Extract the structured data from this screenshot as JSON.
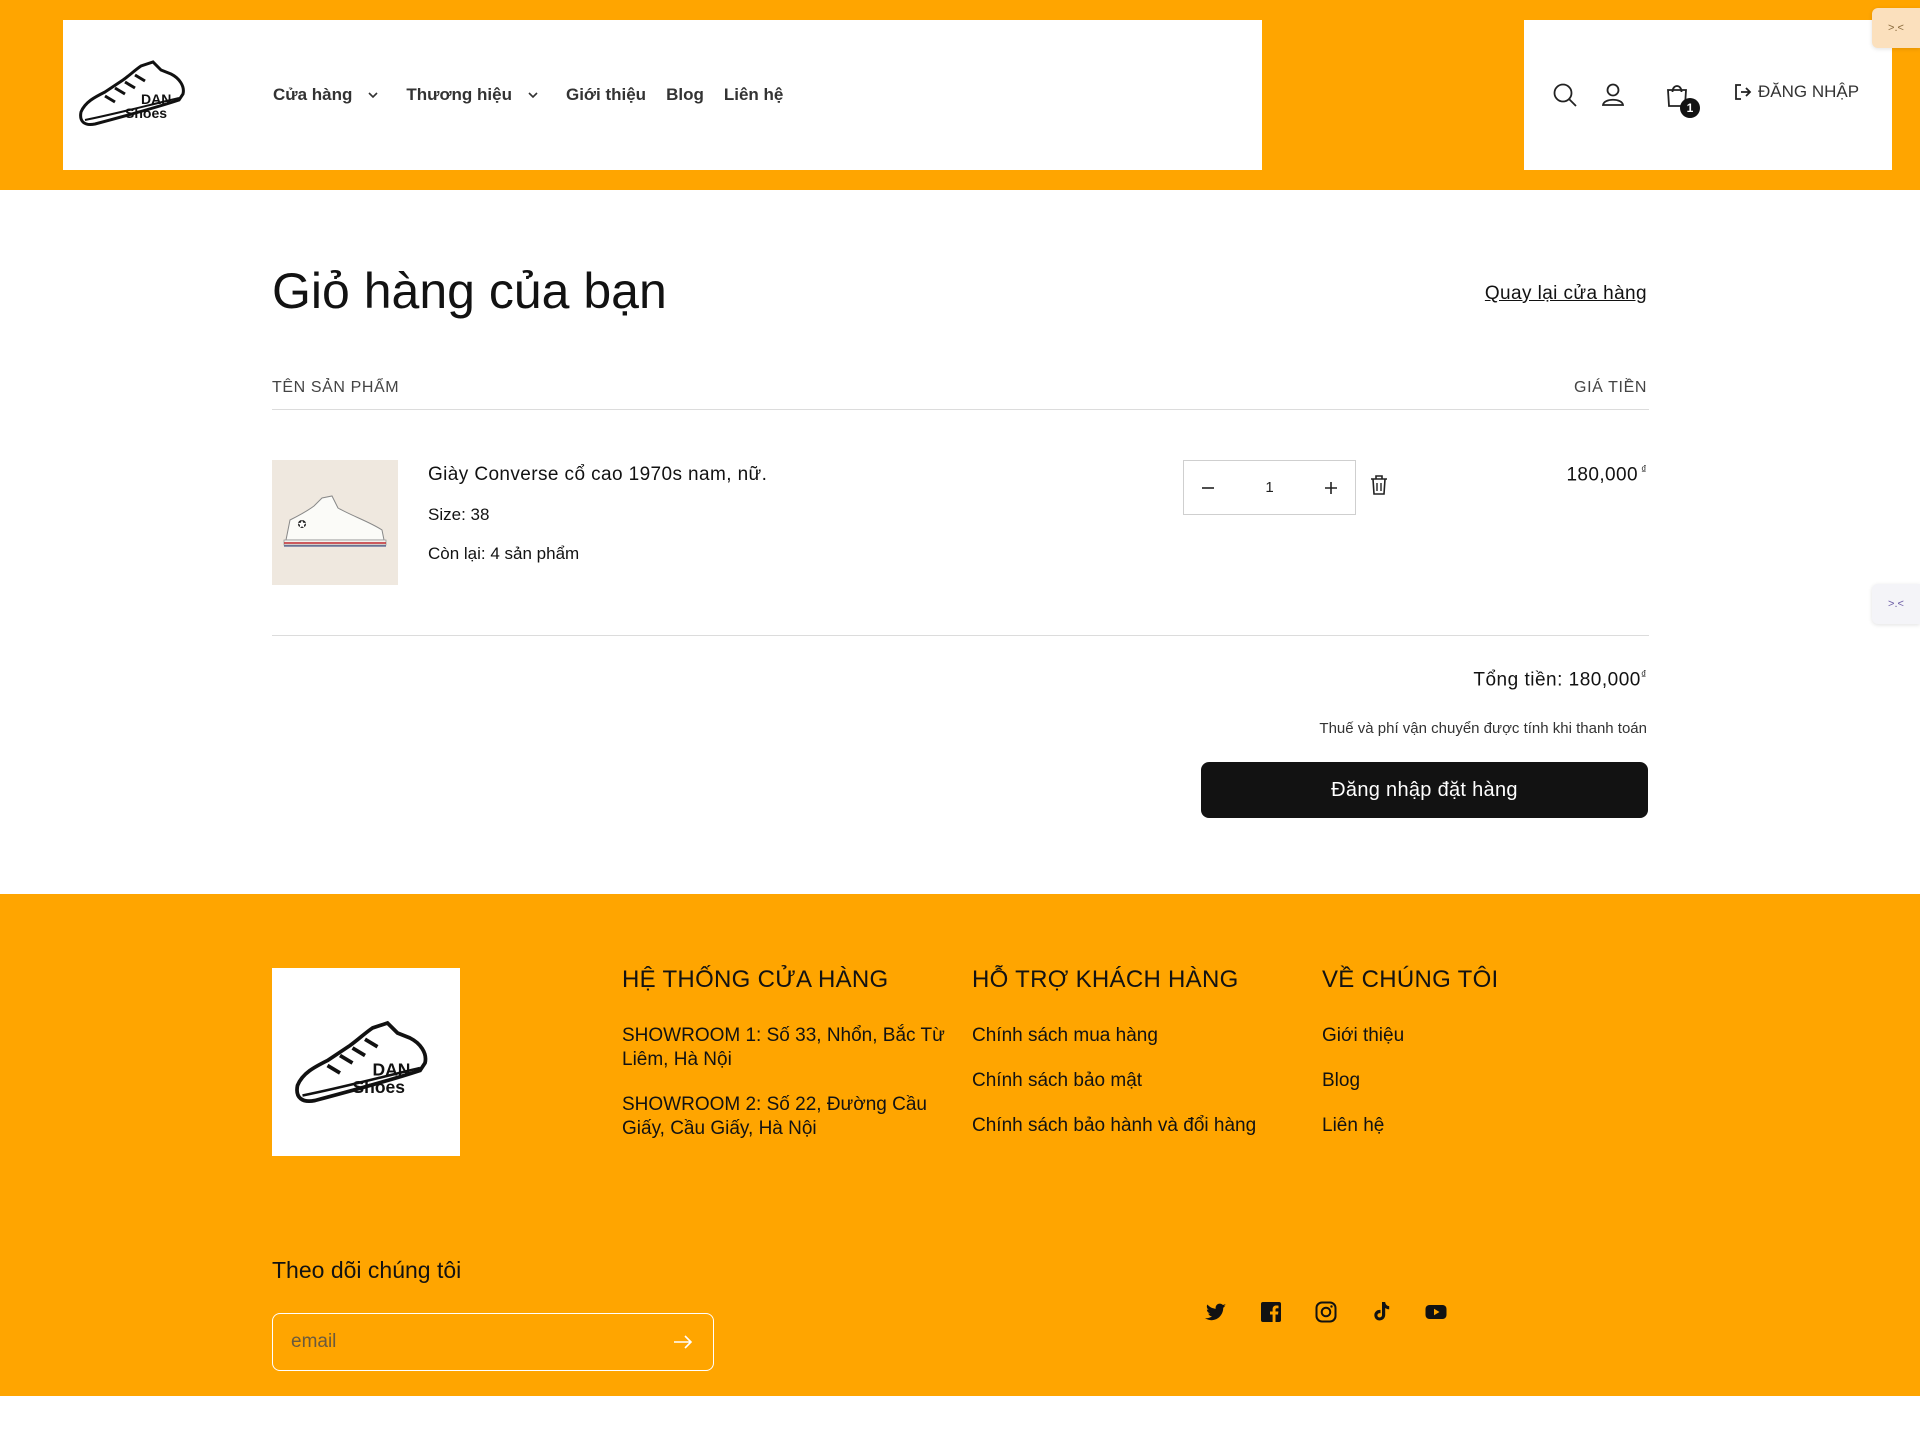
{
  "header": {
    "brand": "DAN Shoes",
    "brand_line1": "DAN",
    "brand_line2": "Shoes",
    "nav": [
      {
        "label": "Cửa hàng",
        "has_dropdown": true
      },
      {
        "label": "Thương hiệu",
        "has_dropdown": true
      },
      {
        "label": "Giới thiệu",
        "has_dropdown": false
      },
      {
        "label": "Blog",
        "has_dropdown": false
      },
      {
        "label": "Liên hệ",
        "has_dropdown": false
      }
    ],
    "icons": [
      "search-icon",
      "account-icon",
      "cart-icon"
    ],
    "cart_count": "1",
    "login_label": "ĐĂNG NHẬP"
  },
  "side_widgets": {
    "top": ">.<",
    "mid": ">.<"
  },
  "cart": {
    "title": "Giỏ hàng của bạn",
    "back_label": "Quay lại cửa hàng",
    "col_product": "TÊN SẢN PHẨM",
    "col_price": "GIÁ TIỀN",
    "items": [
      {
        "name": "Giày Converse cổ cao 1970s nam, nữ.",
        "size": "Size: 38",
        "stock": "Còn lại: 4 sản phẩm",
        "quantity": "1",
        "price": "180,000",
        "currency": "₫"
      }
    ],
    "total_label": "Tổng tiền: 180,000",
    "total_currency": "₫",
    "tax_note": "Thuế và phí vận chuyển được tính khi thanh toán",
    "checkout_label": "Đăng nhập đặt hàng"
  },
  "footer": {
    "columns": [
      {
        "title": "HỆ THỐNG CỬA HÀNG",
        "lines": [
          "SHOWROOM 1: Số 33, Nhổn, Bắc Từ Liêm, Hà Nội",
          "SHOWROOM 2: Số 22, Đường Cầu Giấy, Cầu Giấy, Hà Nội"
        ]
      },
      {
        "title": "HỖ TRỢ KHÁCH HÀNG",
        "links": [
          "Chính sách mua hàng",
          "Chính sách bảo mật",
          "Chính sách bảo hành và đổi hàng"
        ]
      },
      {
        "title": "VỀ CHÚNG TÔI",
        "links": [
          "Giới thiệu",
          "Blog",
          "Liên hệ"
        ]
      }
    ],
    "follow_title": "Theo dõi chúng tôi",
    "email_placeholder": "email",
    "socials": [
      "twitter-icon",
      "facebook-icon",
      "instagram-icon",
      "tiktok-icon",
      "youtube-icon"
    ]
  },
  "colors": {
    "accent": "#ffa500",
    "button": "#121212",
    "background": "#ffffff"
  }
}
